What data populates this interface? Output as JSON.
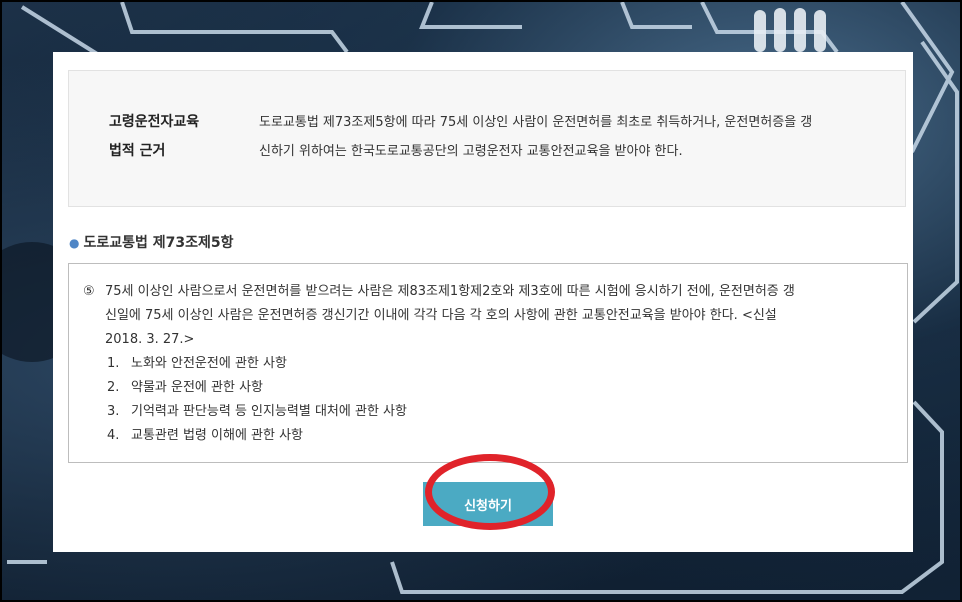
{
  "info": {
    "title_line1": "고령운전자교육",
    "title_line2": "법적 근거",
    "desc_line1": "도로교통법 제73조제5항에 따라 75세 이상인 사람이 운전면허를 최초로 취득하거나, 운전면허증을 갱",
    "desc_line2": "신하기 위하여는 한국도로교통공단의 고령운전자 교통안전교육을 받아야 한다."
  },
  "section": {
    "title": "도로교통법 제73조제5항"
  },
  "law": {
    "para_num": "⑤",
    "para_line1": "75세 이상인 사람으로서 운전면허를 받으려는 사람은 제83조제1항제2호와 제3호에 따른 시험에 응시하기 전에, 운전면허증 갱",
    "para_line2": "신일에 75세 이상인 사람은 운전면허증 갱신기간 이내에 각각 다음 각 호의 사항에 관한 교통안전교육을 받아야 한다. <신설",
    "para_line3": "2018. 3. 27.>",
    "items": [
      {
        "num": "1.",
        "text": "노화와 안전운전에 관한 사항"
      },
      {
        "num": "2.",
        "text": "약물과 운전에 관한 사항"
      },
      {
        "num": "3.",
        "text": "기억력과 판단능력 등 인지능력별 대처에 관한 사항"
      },
      {
        "num": "4.",
        "text": "교통관련 법령 이해에 관한 사항"
      }
    ]
  },
  "button": {
    "apply_label": "신청하기"
  },
  "colors": {
    "button_bg": "#4baac3",
    "highlight_ellipse": "#e0232a",
    "bullet": "#4f86c6"
  }
}
